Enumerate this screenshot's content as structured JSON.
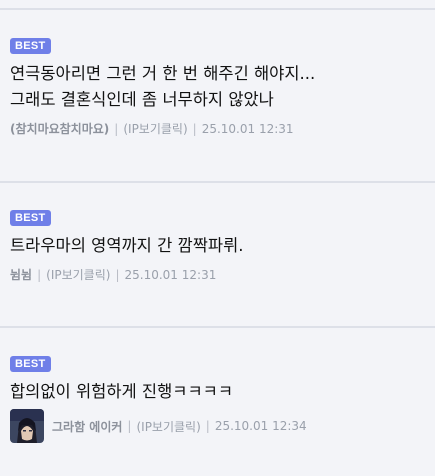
{
  "comments": [
    {
      "badge": "BEST",
      "text": "연극동아리면 그런 거 한 번 해주긴 해야지...\n그래도 결혼식인데 좀 너무하지 않았나",
      "nick": "(참치마요참치마요)",
      "ip": "(IP보기클릭)",
      "date": "25.10.01 12:31"
    },
    {
      "badge": "BEST",
      "text": "트라우마의 영역까지 간 깜짝파뤼.",
      "nick": "뉨뉨",
      "ip": "(IP보기클릭)",
      "date": "25.10.01 12:31"
    },
    {
      "badge": "BEST",
      "text": "합의없이 위험하게 진행ㅋㅋㅋㅋ",
      "nick": "그라함 에이커",
      "ip": "(IP보기클릭)",
      "date": "25.10.01 12:34",
      "avatar_icon": "user-avatar"
    }
  ]
}
